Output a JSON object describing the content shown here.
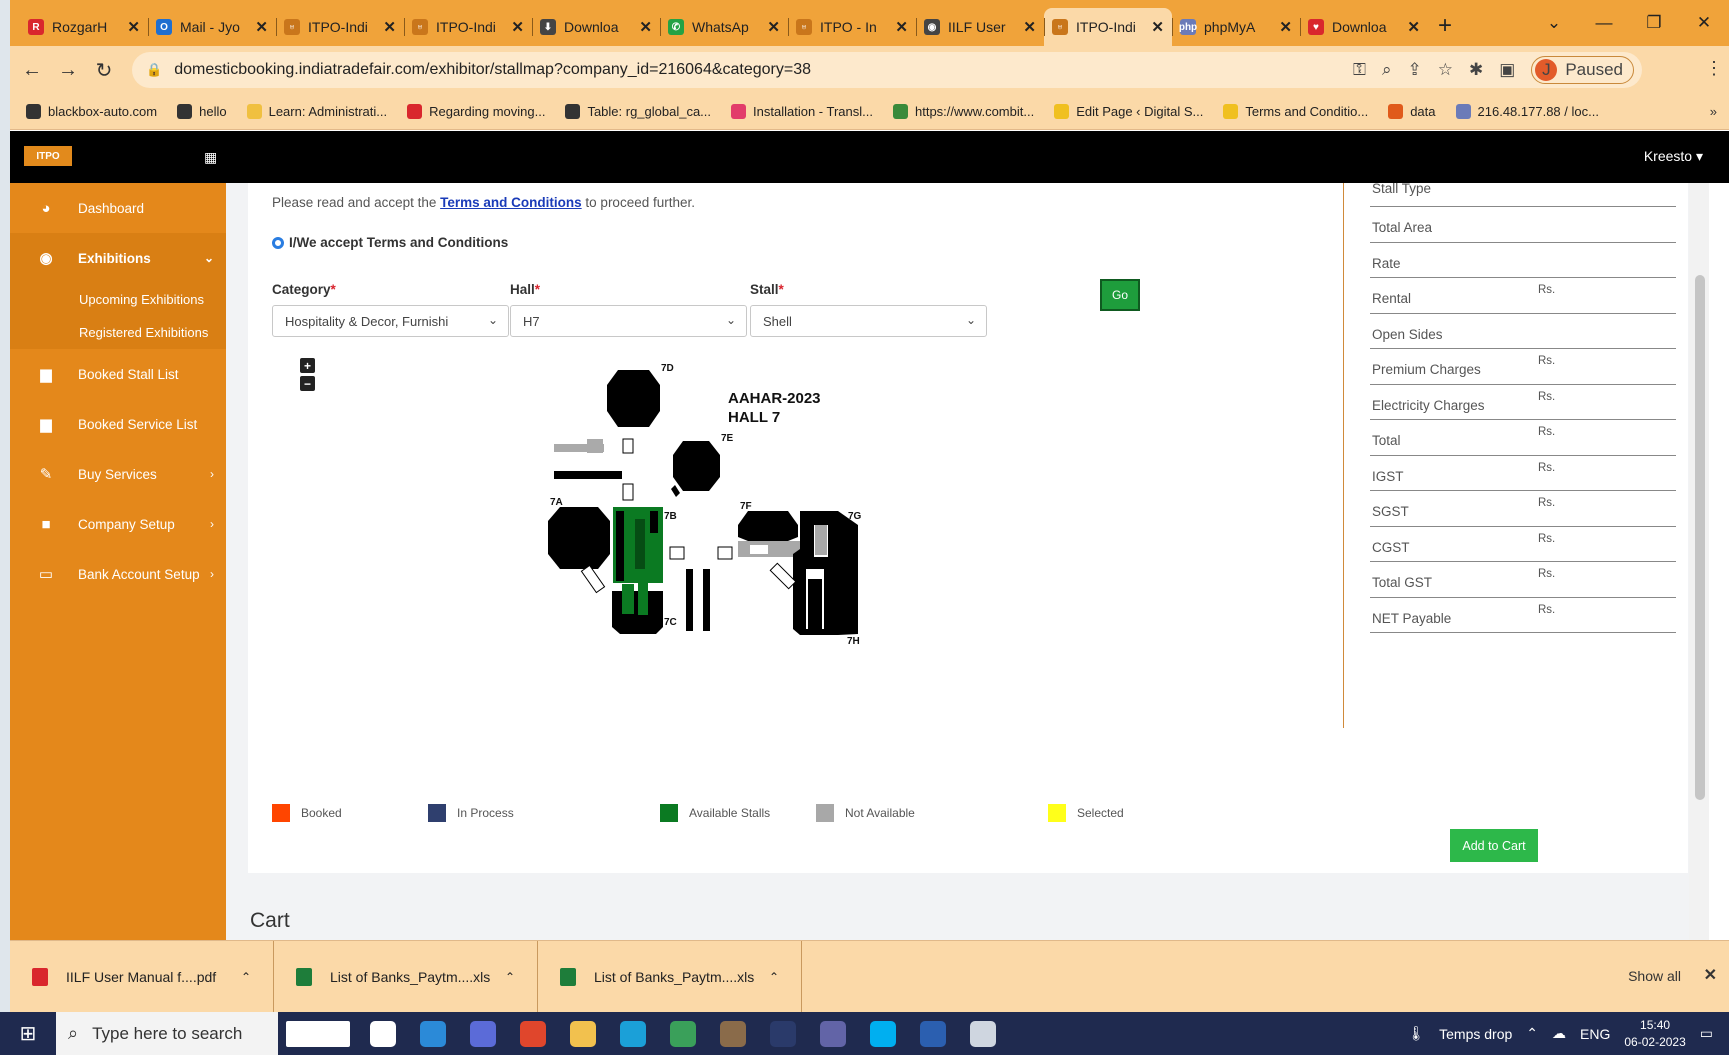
{
  "browser": {
    "tabs": [
      {
        "label": "RozgarH",
        "icon": "rozgar-icon",
        "color": "#d9272d",
        "glyph": "R"
      },
      {
        "label": "Mail - Jyo",
        "icon": "outlook-icon",
        "color": "#1f6fd0",
        "glyph": "O"
      },
      {
        "label": "ITPO-Indi",
        "icon": "itpo-icon",
        "color": "#c9761b",
        "glyph": "♅"
      },
      {
        "label": "ITPO-Indi",
        "icon": "itpo-icon",
        "color": "#c9761b",
        "glyph": "♅"
      },
      {
        "label": "Downloa",
        "icon": "download-icon",
        "color": "#444444",
        "glyph": "⬇"
      },
      {
        "label": "WhatsAp",
        "icon": "whatsapp-icon",
        "color": "#25a244",
        "glyph": "✆"
      },
      {
        "label": "ITPO - In",
        "icon": "itpo-icon",
        "color": "#c9761b",
        "glyph": "♅"
      },
      {
        "label": "IILF User",
        "icon": "globe-icon",
        "color": "#444444",
        "glyph": "◉"
      },
      {
        "label": "ITPO-Indi",
        "icon": "itpo-icon",
        "color": "#c9761b",
        "glyph": "♅",
        "active": true
      },
      {
        "label": "phpMyA",
        "icon": "phpmyadmin-icon",
        "color": "#6b7bb8",
        "glyph": "php"
      },
      {
        "label": "Downloa",
        "icon": "heart-icon",
        "color": "#d9272d",
        "glyph": "♥"
      }
    ],
    "url": "domesticbooking.indiatradefair.com/exhibitor/stallmap?company_id=216064&category=38",
    "profile_initial": "J",
    "profile_status": "Paused",
    "bookmarks": [
      {
        "label": "blackbox-auto.com",
        "color": "#333333"
      },
      {
        "label": "hello",
        "color": "#333333"
      },
      {
        "label": "Learn: Administrati...",
        "color": "#f0c040"
      },
      {
        "label": "Regarding moving...",
        "color": "#d9272d"
      },
      {
        "label": "Table: rg_global_ca...",
        "color": "#333333"
      },
      {
        "label": "Installation - Transl...",
        "color": "#e23c6a"
      },
      {
        "label": "https://www.combit...",
        "color": "#3a8a3a"
      },
      {
        "label": "Edit Page ‹ Digital S...",
        "color": "#f0c020"
      },
      {
        "label": "Terms and Conditio...",
        "color": "#f0c020"
      },
      {
        "label": "data",
        "color": "#e05a1a"
      },
      {
        "label": "216.48.177.88 / loc...",
        "color": "#6b7bb8"
      }
    ]
  },
  "app": {
    "logo_text": "ITPO",
    "user": "Kreesto ▾"
  },
  "sidebar": {
    "items": [
      {
        "label": "Dashboard",
        "icon": "dashboard-icon",
        "glyph": "◕"
      },
      {
        "label": "Exhibitions",
        "icon": "globe-icon",
        "glyph": "◉",
        "active": true,
        "chevron": "⌄"
      },
      {
        "label": "Booked Stall List",
        "icon": "inbox-icon",
        "glyph": "▆"
      },
      {
        "label": "Booked Service List",
        "icon": "inbox-icon",
        "glyph": "▆"
      },
      {
        "label": "Buy Services",
        "icon": "wrench-icon",
        "glyph": "✎",
        "chevron": "›"
      },
      {
        "label": "Company Setup",
        "icon": "briefcase-icon",
        "glyph": "■",
        "chevron": "›"
      },
      {
        "label": "Bank Account Setup",
        "icon": "credit-card-icon",
        "glyph": "▭",
        "chevron": "›"
      }
    ],
    "subitems": [
      "Upcoming Exhibitions",
      "Registered Exhibitions"
    ]
  },
  "form": {
    "terms_prefix": "Please read and accept the",
    "terms_link": "Terms and Conditions",
    "terms_suffix": "to proceed further.",
    "accept_label": "I/We accept Terms and Conditions",
    "category_label": "Category",
    "category_value": "Hospitality & Decor, Furnishi",
    "hall_label": "Hall",
    "hall_value": "H7",
    "stall_label": "Stall",
    "stall_value": "Shell",
    "required_mark": "*",
    "go_label": "Go",
    "zoom_in": "+",
    "zoom_out": "−"
  },
  "map": {
    "title_line1": "AAHAR-2023",
    "title_line2": "HALL 7",
    "labels": [
      "7D",
      "7E",
      "7A",
      "7B",
      "7F",
      "7G",
      "7C",
      "7H"
    ]
  },
  "legend": [
    {
      "label": "Booked",
      "color": "#ff4500"
    },
    {
      "label": "In Process",
      "color": "#2f3f6e"
    },
    {
      "label": "Available Stalls",
      "color": "#0b7a22"
    },
    {
      "label": "Not Available",
      "color": "#a8a8a8"
    },
    {
      "label": "Selected",
      "color": "#ffff1a"
    }
  ],
  "summary": {
    "currency": "Rs.",
    "rows": [
      {
        "label": "Stall Type",
        "currency": false
      },
      {
        "label": "Total Area",
        "currency": false
      },
      {
        "label": "Rate",
        "currency": false
      },
      {
        "label": "Rental",
        "currency": true
      },
      {
        "label": "Open Sides",
        "currency": false
      },
      {
        "label": "Premium Charges",
        "currency": true
      },
      {
        "label": "Electricity Charges",
        "currency": true
      },
      {
        "label": "Total",
        "currency": true
      },
      {
        "label": "IGST",
        "currency": true
      },
      {
        "label": "SGST",
        "currency": true
      },
      {
        "label": "CGST",
        "currency": true
      },
      {
        "label": "Total GST",
        "currency": true
      },
      {
        "label": "NET Payable",
        "currency": true
      }
    ],
    "add_to_cart": "Add to Cart"
  },
  "cart_title": "Cart",
  "downloads": {
    "items": [
      {
        "label": "IILF User Manual f....pdf",
        "icon": "pdf-icon",
        "color": "#d9272d"
      },
      {
        "label": "List of Banks_Paytm....xls",
        "icon": "excel-icon",
        "color": "#1e7d3a"
      },
      {
        "label": "List of Banks_Paytm....xls",
        "icon": "excel-icon",
        "color": "#1e7d3a"
      }
    ],
    "show_all": "Show all"
  },
  "taskbar": {
    "search_placeholder": "Type here to search",
    "weather": "Temps drop",
    "language": "ENG",
    "time": "15:40",
    "date": "06-02-2023",
    "apps": [
      {
        "icon": "mount-tabor-icon",
        "color": "#ffffff"
      },
      {
        "icon": "task-view-icon",
        "color": "#ffffff"
      },
      {
        "icon": "vscode-icon",
        "color": "#2b8ad8"
      },
      {
        "icon": "app-icon",
        "color": "#5b6bd8"
      },
      {
        "icon": "chrome-icon",
        "color": "#e0462c"
      },
      {
        "icon": "file-explorer-icon",
        "color": "#f2c14e"
      },
      {
        "icon": "edge-icon",
        "color": "#1ba0d8"
      },
      {
        "icon": "photos-icon",
        "color": "#3aa05a"
      },
      {
        "icon": "app-icon",
        "color": "#8a6b4a"
      },
      {
        "icon": "tl-icon",
        "color": "#2a3a6a"
      },
      {
        "icon": "teams-icon",
        "color": "#6264a7"
      },
      {
        "icon": "skype-icon",
        "color": "#00aff0"
      },
      {
        "icon": "word-icon",
        "color": "#2b5fb0"
      },
      {
        "icon": "app-icon",
        "color": "#cfd6e0"
      }
    ]
  }
}
